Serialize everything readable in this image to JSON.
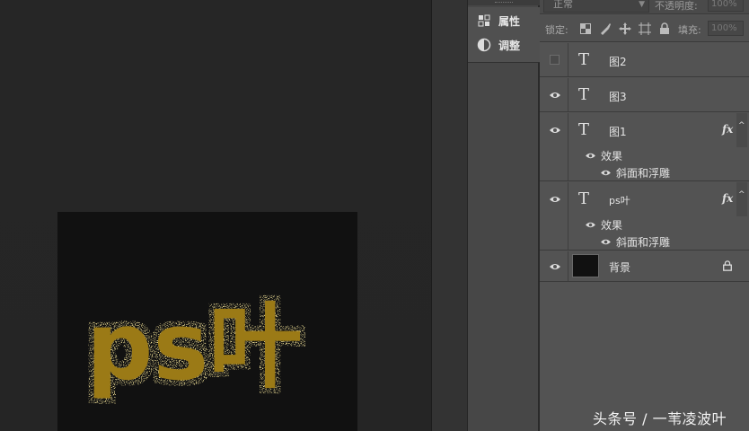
{
  "canvas": {
    "artwork_text": "ps叶",
    "artwork_color": "#9b7a14"
  },
  "dock": {
    "items": [
      {
        "label": "属性",
        "icon": "properties-icon"
      },
      {
        "label": "调整",
        "icon": "adjustments-icon"
      }
    ]
  },
  "layers_panel": {
    "blend_mode": "正常",
    "opacity_label": "不透明度:",
    "opacity_value": "100%",
    "lock_label": "锁定:",
    "fill_label": "填充:",
    "fill_value": "100%",
    "layers": [
      {
        "name": "图2",
        "type": "text",
        "visible": false
      },
      {
        "name": "图3",
        "type": "text",
        "visible": true
      },
      {
        "name": "图1",
        "type": "text",
        "visible": true,
        "fx": "fx",
        "effects_label": "效果",
        "effect": "斜面和浮雕"
      },
      {
        "name": "ps叶",
        "type": "text",
        "visible": true,
        "fx": "fx",
        "effects_label": "效果",
        "effect": "斜面和浮雕"
      },
      {
        "name": "背景",
        "type": "background",
        "visible": true,
        "locked": true
      }
    ]
  },
  "watermark": "头条号 / 一苇凌波叶"
}
